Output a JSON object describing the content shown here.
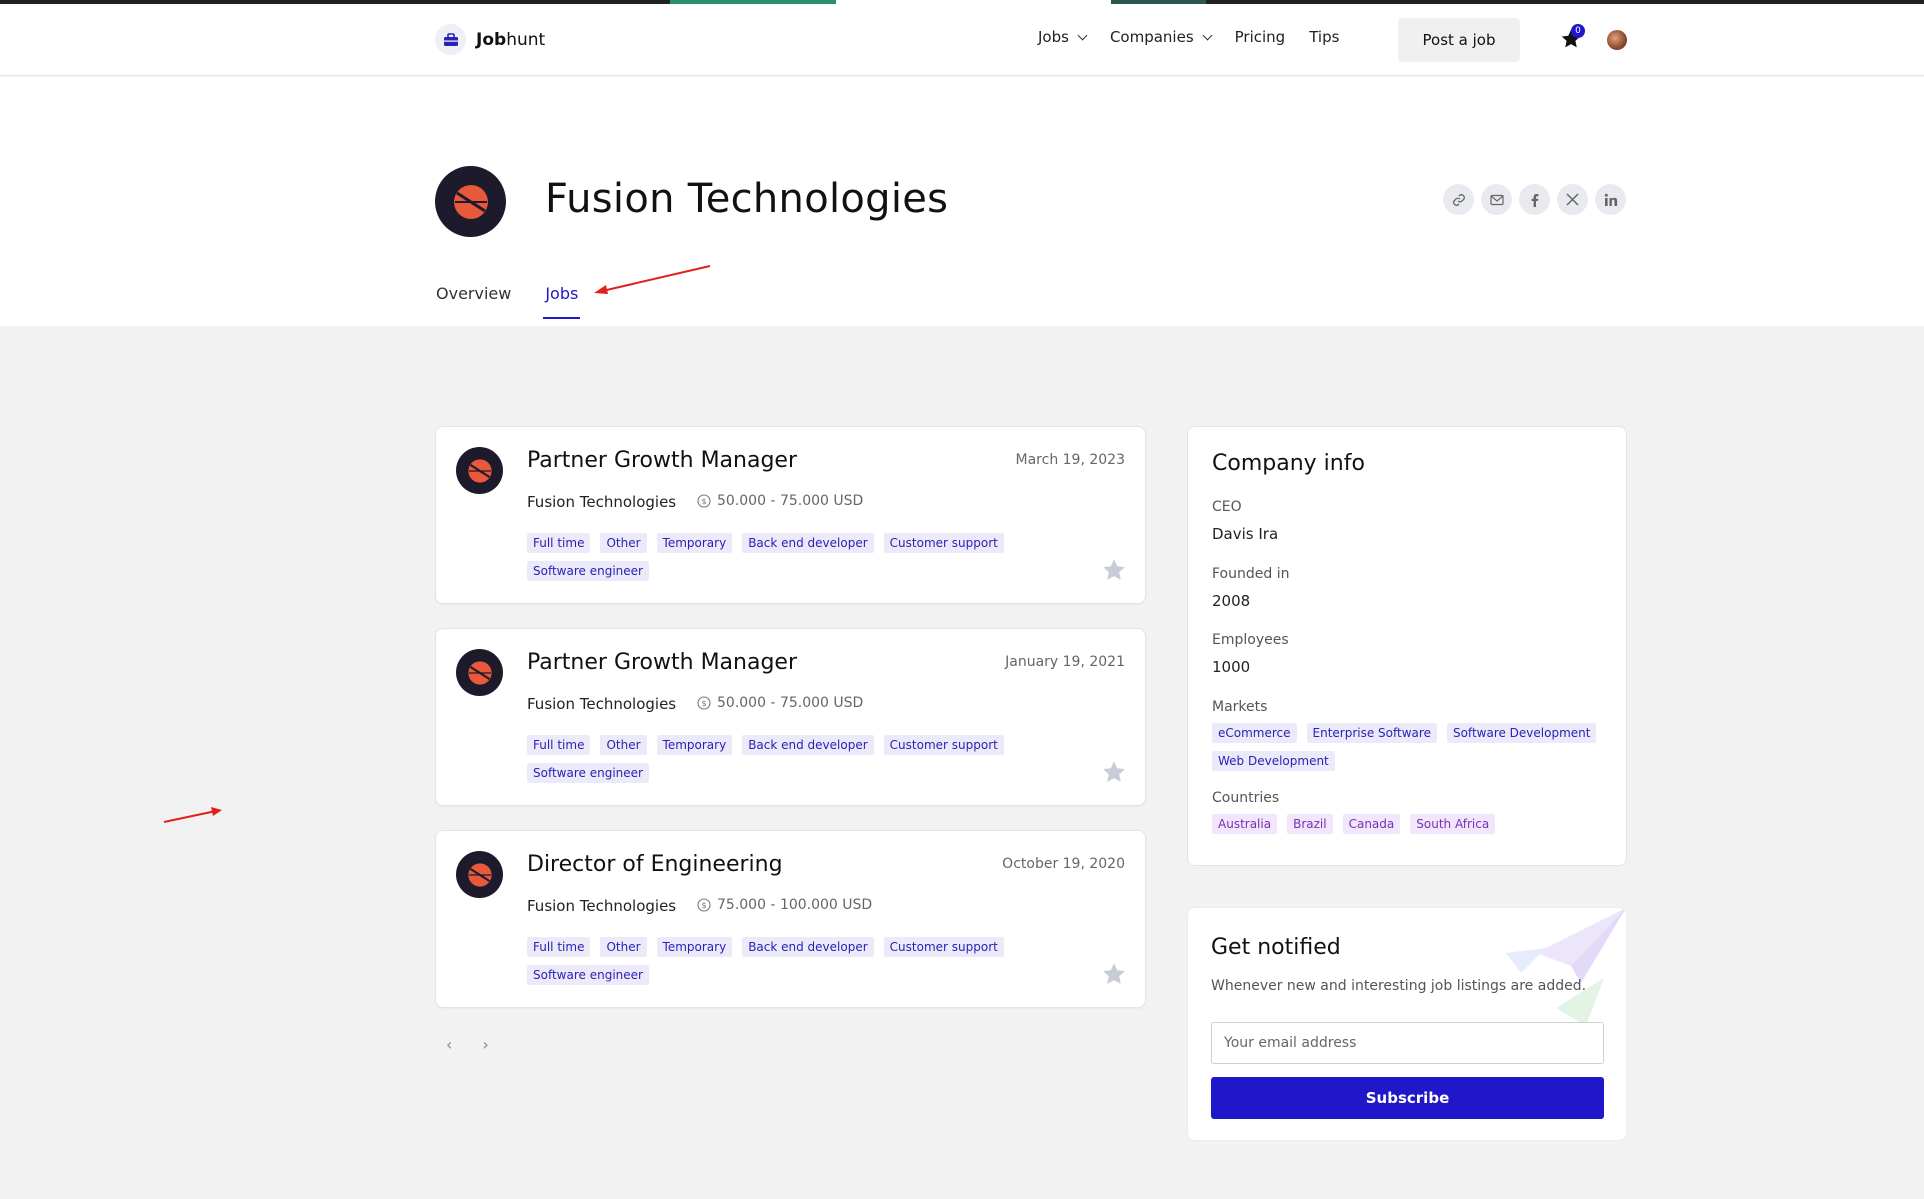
{
  "header": {
    "logo_bold": "Job",
    "logo_rest": "hunt",
    "nav": [
      {
        "label": "Jobs",
        "dropdown": true
      },
      {
        "label": "Companies",
        "dropdown": true
      },
      {
        "label": "Pricing",
        "dropdown": false
      },
      {
        "label": "Tips",
        "dropdown": false
      }
    ],
    "post_job_label": "Post a job",
    "favorites_count": "0"
  },
  "company": {
    "name": "Fusion Technologies",
    "tabs": [
      {
        "label": "Overview",
        "active": false
      },
      {
        "label": "Jobs",
        "active": true
      }
    ],
    "share_icons": [
      "link-icon",
      "email-icon",
      "facebook-icon",
      "x-icon",
      "linkedin-icon"
    ]
  },
  "jobs": [
    {
      "title": "Partner Growth Manager",
      "date": "March 19, 2023",
      "company": "Fusion Technologies",
      "salary": "50.000 - 75.000 USD",
      "tags": [
        "Full time",
        "Other",
        "Temporary",
        "Back end developer",
        "Customer support",
        "Software engineer"
      ]
    },
    {
      "title": "Partner Growth Manager",
      "date": "January 19, 2021",
      "company": "Fusion Technologies",
      "salary": "50.000 - 75.000 USD",
      "tags": [
        "Full time",
        "Other",
        "Temporary",
        "Back end developer",
        "Customer support",
        "Software engineer"
      ]
    },
    {
      "title": "Director of Engineering",
      "date": "October 19, 2020",
      "company": "Fusion Technologies",
      "salary": "75.000 - 100.000 USD",
      "tags": [
        "Full time",
        "Other",
        "Temporary",
        "Back end developer",
        "Customer support",
        "Software engineer"
      ]
    }
  ],
  "pagination": {
    "prev": "‹",
    "next": "›"
  },
  "company_info": {
    "title": "Company info",
    "ceo_label": "CEO",
    "ceo": "Davis Ira",
    "founded_label": "Founded in",
    "founded": "2008",
    "employees_label": "Employees",
    "employees": "1000",
    "markets_label": "Markets",
    "markets": [
      "eCommerce",
      "Enterprise Software",
      "Software Development",
      "Web Development"
    ],
    "countries_label": "Countries",
    "countries": [
      "Australia",
      "Brazil",
      "Canada",
      "South Africa"
    ]
  },
  "notify": {
    "title": "Get notified",
    "text": "Whenever new and interesting job listings are added.",
    "email_placeholder": "Your email address",
    "subscribe_label": "Subscribe"
  },
  "colors": {
    "accent": "#1f17c9",
    "company_logo_bg": "#1c1a2b",
    "company_logo_fg": "#e8583a"
  }
}
